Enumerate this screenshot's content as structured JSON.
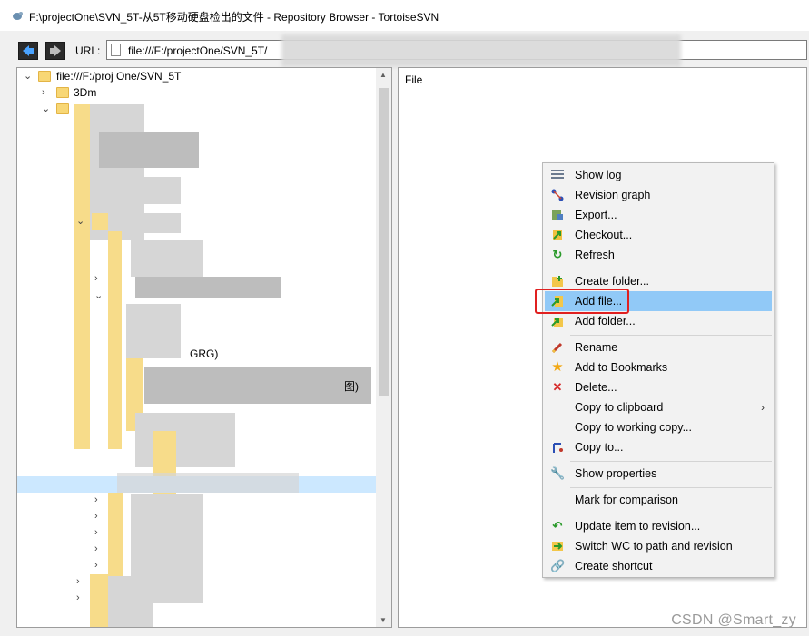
{
  "window": {
    "title": "F:\\projectOne\\SVN_5T-从5T移动硬盘检出的文件 - Repository Browser - TortoiseSVN"
  },
  "navbar": {
    "url_label": "URL:",
    "url_value": "file:///F:/projectOne/SVN_5T/"
  },
  "tree": {
    "root_label": "file:///F:/proj      One/SVN_5T",
    "visible_labels": [
      "3Dm",
      "GRG)",
      "图)"
    ]
  },
  "file_pane": {
    "column_header": "File"
  },
  "context_menu": {
    "items": [
      {
        "label": "Show log",
        "icon": "show-log-icon"
      },
      {
        "label": "Revision graph",
        "icon": "revision-graph-icon"
      },
      {
        "label": "Export...",
        "icon": "export-icon"
      },
      {
        "label": "Checkout...",
        "icon": "checkout-icon"
      },
      {
        "label": "Refresh",
        "icon": "refresh-icon"
      },
      {
        "label": "Create folder...",
        "icon": "create-folder-icon"
      },
      {
        "label": "Add file...",
        "icon": "add-file-icon",
        "highlighted": true
      },
      {
        "label": "Add folder...",
        "icon": "add-folder-icon"
      },
      {
        "label": "Rename",
        "icon": "rename-icon"
      },
      {
        "label": "Add to Bookmarks",
        "icon": "bookmark-star-icon"
      },
      {
        "label": "Delete...",
        "icon": "delete-icon"
      },
      {
        "label": "Copy to clipboard",
        "icon": "",
        "submenu": "›"
      },
      {
        "label": "Copy to working copy...",
        "icon": ""
      },
      {
        "label": "Copy to...",
        "icon": "copy-to-icon"
      },
      {
        "label": "Show properties",
        "icon": "properties-wrench-icon"
      },
      {
        "label": "Mark for comparison",
        "icon": ""
      },
      {
        "label": "Update item to revision...",
        "icon": "update-revision-icon"
      },
      {
        "label": "Switch WC to path and revision",
        "icon": "switch-wc-icon"
      },
      {
        "label": "Create shortcut",
        "icon": "shortcut-link-icon"
      }
    ]
  },
  "colors": {
    "highlight": "#91c9f7",
    "annotation_box": "#e02020",
    "selected_row": "#cce8ff"
  },
  "watermark": "CSDN @Smart_zy"
}
